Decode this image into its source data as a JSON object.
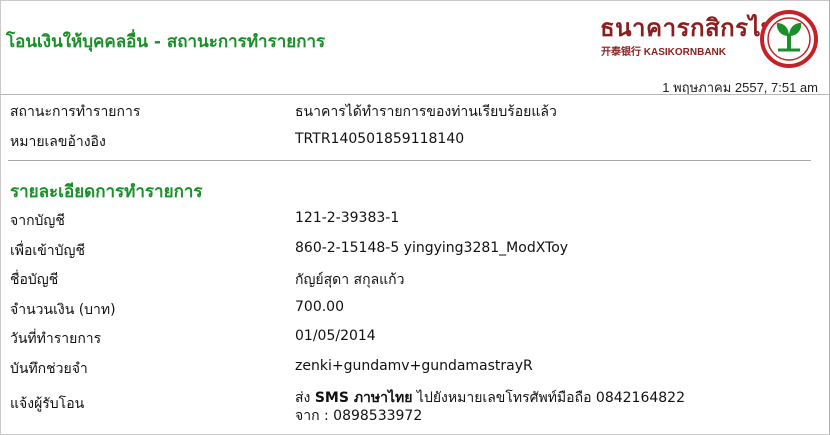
{
  "header": {
    "title": "โอนเงินให้บุคคลอื่น - สถานะการทำรายการ",
    "bank_name_th": "ธนาคารกสิกรไทย",
    "bank_name_en": "开泰银行 KASIKORNBANK",
    "timestamp": "1 พฤษภาคม 2557, 7:51 am"
  },
  "status": {
    "status_label": "สถานะการทำรายการ",
    "status_value": "ธนาคารได้ทำรายการของท่านเรียบร้อยแล้ว",
    "ref_label": "หมายเลขอ้างอิง",
    "ref_value": "TRTR140501859118140"
  },
  "details": {
    "section_title": "รายละเอียดการทำรายการ",
    "from_label": "จากบัญชี",
    "from_value": "121-2-39383-1",
    "to_label": "เพื่อเข้าบัญชี",
    "to_value": "860-2-15148-5 yingying3281_ModXToy",
    "name_label": "ชื่อบัญชี",
    "name_value": "กัญย์สุดา สกุลแก้ว",
    "amount_label": "จำนวนเงิน (บาท)",
    "amount_value": "700.00",
    "date_label": "วันที่ทำรายการ",
    "date_value": "01/05/2014",
    "memo_label": "บันทึกช่วยจำ",
    "memo_value": "zenki+gundamv+gundamastrayR",
    "notify_label": "แจ้งผู้รับโอน",
    "notify_prefix": "ส่ง",
    "notify_sms": "SMS ภาษาไทย",
    "notify_rest": "ไปยังหมายเลขโทรศัพท์มือถือ 0842164822",
    "notify_from": "จาก : 0898533972"
  },
  "colors": {
    "accent_green": "#1a8f2a",
    "brand_red": "#8a1f1f",
    "logo_circle": "#c62127",
    "logo_leaf": "#1a8f2a"
  },
  "icons": {
    "logo": "kasikornbank-logo-icon"
  }
}
